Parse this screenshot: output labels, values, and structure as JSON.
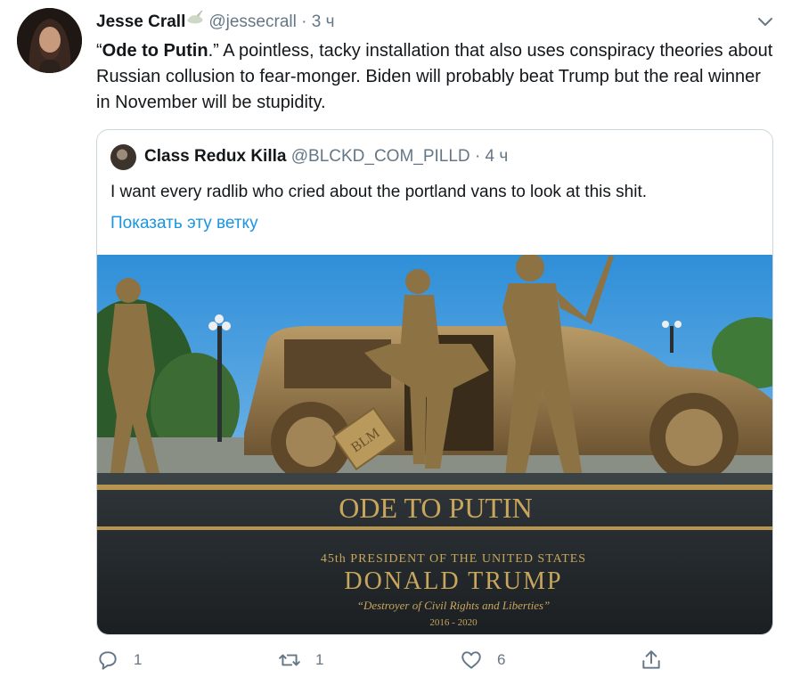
{
  "tweet": {
    "author_name": "Jesse Crall",
    "author_handle": "@jessecrall",
    "separator": "·",
    "time": "3 ч",
    "text_open_quote": "“",
    "text_bold": "Ode to Putin",
    "text_rest": ".” A pointless, tacky installation that also uses conspiracy theories about Russian collusion to fear-monger. Biden will probably beat Trump but the real winner in November will be stupidity."
  },
  "quoted": {
    "author_name": "Class Redux Killa",
    "author_handle": "@BLCKD_COM_PILLD",
    "separator": "·",
    "time": "4 ч",
    "text": "I want every radlib who cried about the portland vans to look at this shit.",
    "thread_link": "Показать эту ветку",
    "image": {
      "plaque_title": "ODE TO PUTIN",
      "plaque_line1": "45th PRESIDENT OF THE UNITED STATES",
      "plaque_name": "DONALD TRUMP",
      "plaque_quote": "“Destroyer of Civil Rights and Liberties”",
      "plaque_years": "2016 - 2020",
      "sign_text": "BLM"
    }
  },
  "actions": {
    "replies": "1",
    "retweets": "1",
    "likes": "6"
  },
  "icons": {
    "reply": "reply-icon",
    "retweet": "retweet-icon",
    "like": "heart-icon",
    "share": "share-icon",
    "menu": "chevron-down-icon",
    "badge": "dove-icon"
  },
  "colors": {
    "link": "#1b95e0",
    "muted": "#657786",
    "border": "#ccd6dd",
    "text": "#14171a"
  }
}
